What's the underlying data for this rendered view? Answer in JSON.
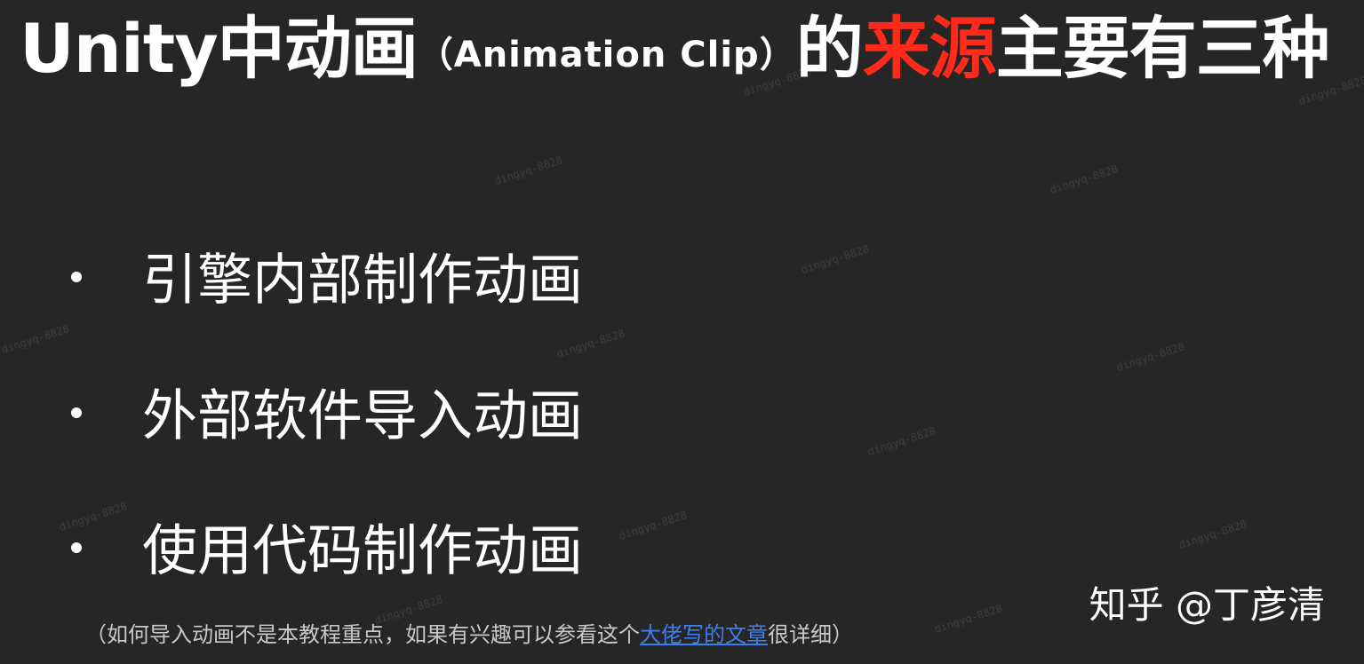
{
  "title": {
    "part1": "Unity中动画",
    "part2": "（Animation Clip）",
    "part3": "的",
    "highlight": "来源",
    "part4": "主要有三种",
    "highlight_color": "#ff2a1a"
  },
  "bullets": [
    {
      "text": "引擎内部制作动画"
    },
    {
      "text": "外部软件导入动画"
    },
    {
      "text": "使用代码制作动画"
    }
  ],
  "note": {
    "before": "（如何导入动画不是本教程重点，如果有兴趣可以参看这个",
    "link": "大佬写的文章",
    "after": "很详细）",
    "link_color": "#3d7ef0"
  },
  "credit": "知乎 @丁彦清",
  "watermark_text": "dingyq-8828"
}
